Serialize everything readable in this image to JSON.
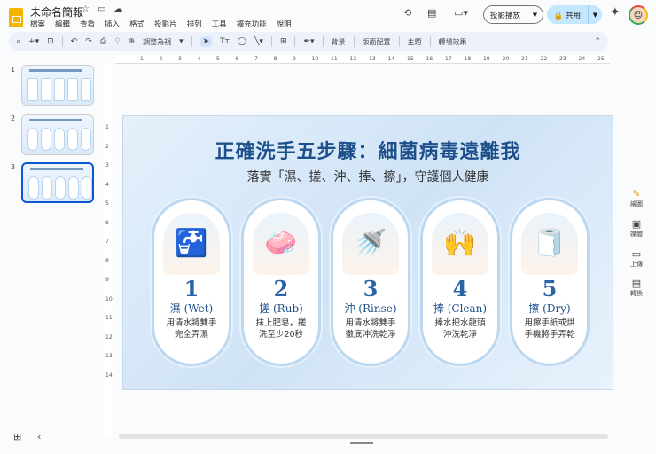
{
  "app": {
    "title": "未命名簡報"
  },
  "menu": [
    "檔案",
    "編輯",
    "查看",
    "插入",
    "格式",
    "投影片",
    "排列",
    "工具",
    "擴充功能",
    "說明"
  ],
  "toolbar": {
    "zoom_label": "調整為視",
    "background": "背景",
    "layout": "版面配置",
    "theme": "主題",
    "transition": "轉場效果"
  },
  "header": {
    "present_label": "投影播放",
    "share_label": "共用"
  },
  "thumbnails": [
    {
      "num": "1"
    },
    {
      "num": "2"
    },
    {
      "num": "3"
    }
  ],
  "ruler_top": [
    "1",
    "2",
    "3",
    "4",
    "5",
    "6",
    "7",
    "8",
    "9",
    "10",
    "11",
    "12",
    "13",
    "14",
    "15",
    "16",
    "17",
    "18",
    "19",
    "20",
    "21",
    "22",
    "23",
    "24",
    "25"
  ],
  "ruler_left": [
    "1",
    "2",
    "3",
    "4",
    "5",
    "6",
    "7",
    "8",
    "9",
    "10",
    "11",
    "12",
    "13",
    "14"
  ],
  "slide": {
    "title": "正確洗手五步驟：細菌病毒遠離我",
    "subtitle": "落實「濕、搓、沖、捧、擦」，守護個人健康",
    "steps": [
      {
        "num": "1",
        "label": "濕 (Wet)",
        "desc1": "用清水將雙手",
        "desc2": "完全弄濕",
        "icon": "🚰"
      },
      {
        "num": "2",
        "label": "搓 (Rub)",
        "desc1": "抹上肥皂，搓",
        "desc2": "洗至少20秒",
        "icon": "🧼"
      },
      {
        "num": "3",
        "label": "沖 (Rinse)",
        "desc1": "用清水將雙手",
        "desc2": "徹底沖洗乾淨",
        "icon": "🚿"
      },
      {
        "num": "4",
        "label": "捧 (Clean)",
        "desc1": "捧水把水龍頭",
        "desc2": "沖洗乾淨",
        "icon": "🙌"
      },
      {
        "num": "5",
        "label": "擦 (Dry)",
        "desc1": "用擦手紙或烘",
        "desc2": "手機將手弄乾",
        "icon": "🧻"
      }
    ]
  },
  "side_panel": [
    {
      "label": "繪圖",
      "icon": "✎"
    },
    {
      "label": "媒體",
      "icon": "▣"
    },
    {
      "label": "上傳",
      "icon": "▭"
    },
    {
      "label": "轉換",
      "icon": "▤"
    }
  ]
}
